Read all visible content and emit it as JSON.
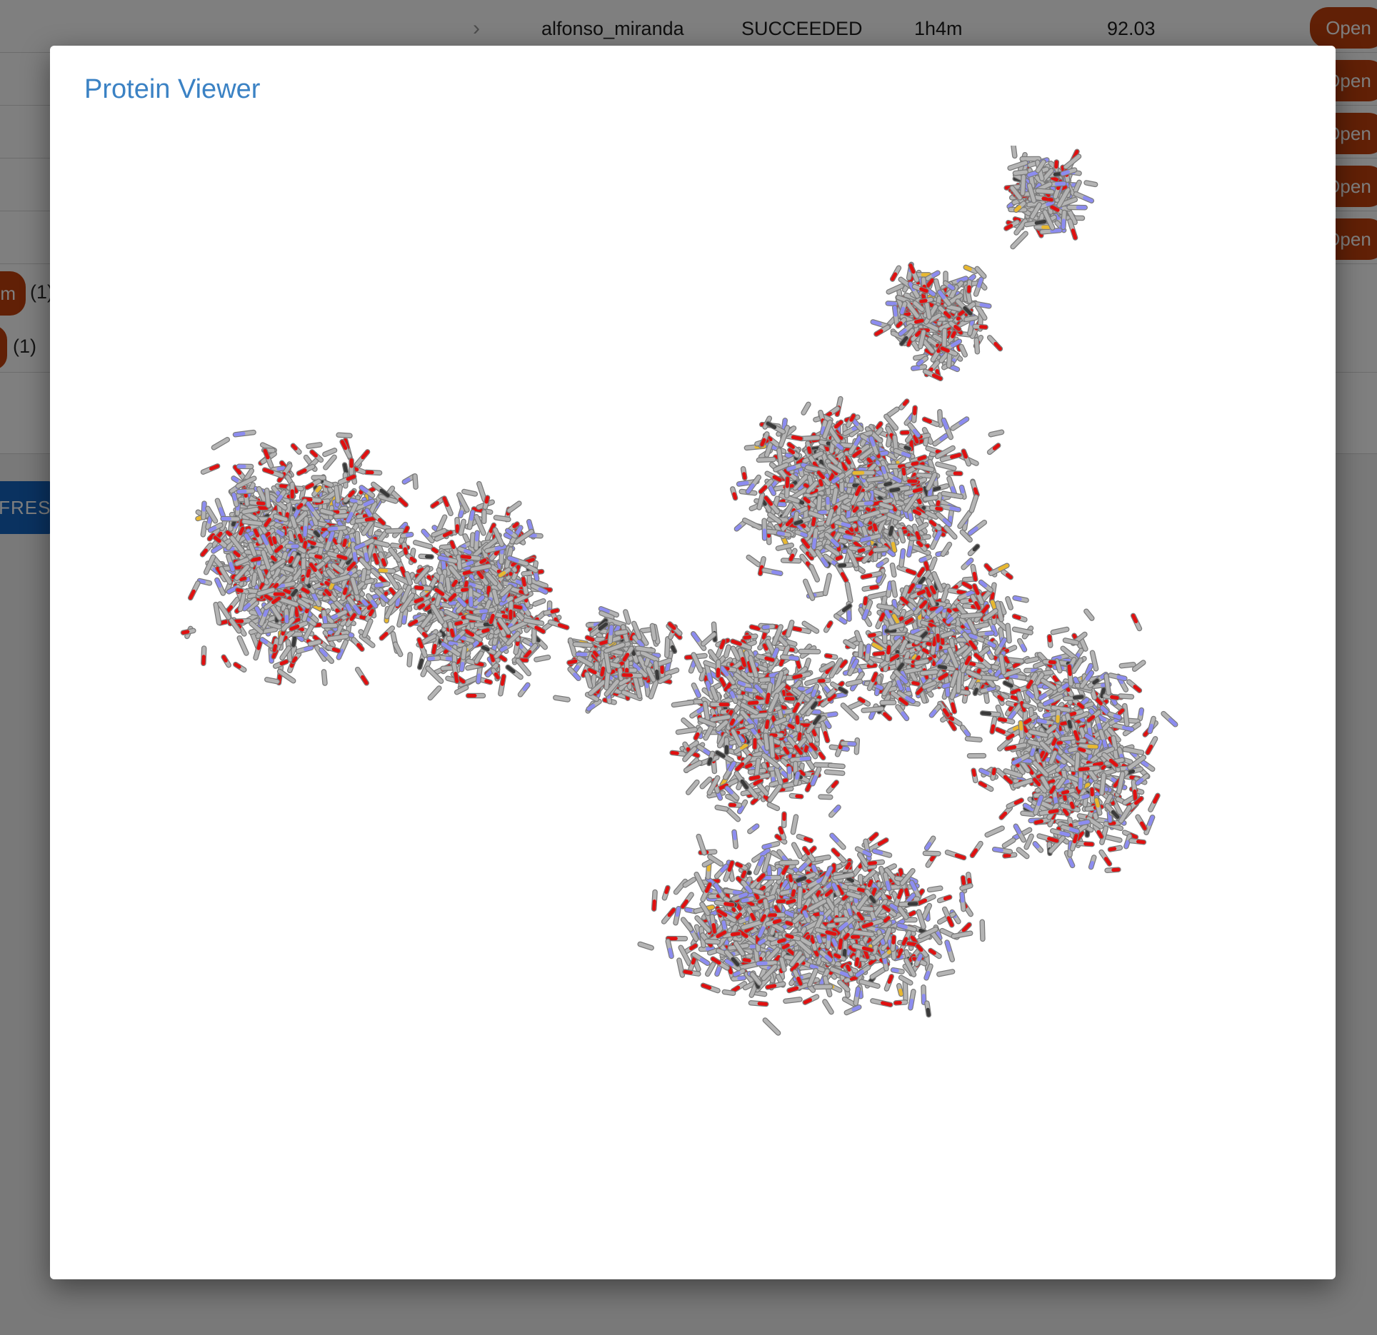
{
  "background": {
    "rows": [
      {
        "user": "alfonso_miranda",
        "status": "SUCCEEDED",
        "duration": "1h4m",
        "score": "92.03",
        "action": "Open"
      },
      {
        "action": "Open"
      },
      {
        "action": "Open"
      },
      {
        "action": "Open"
      },
      {
        "action": "Open"
      }
    ],
    "filter_chips": [
      {
        "label": "m",
        "count": "(1)"
      },
      {
        "label": "",
        "count": "(1)"
      }
    ],
    "refresh_label": "REFRESH"
  },
  "modal": {
    "title": "Protein Viewer"
  },
  "viewer": {
    "representation": "licorice",
    "colors": {
      "carbon": "#b4b4b4",
      "oxygen": "#e01010",
      "nitrogen": "#8c8cf0",
      "sulfur": "#e8b830",
      "dark": "#3a3a3a",
      "title": "#3b82c4",
      "button": "#c2410c",
      "refresh": "#1565c0"
    }
  }
}
